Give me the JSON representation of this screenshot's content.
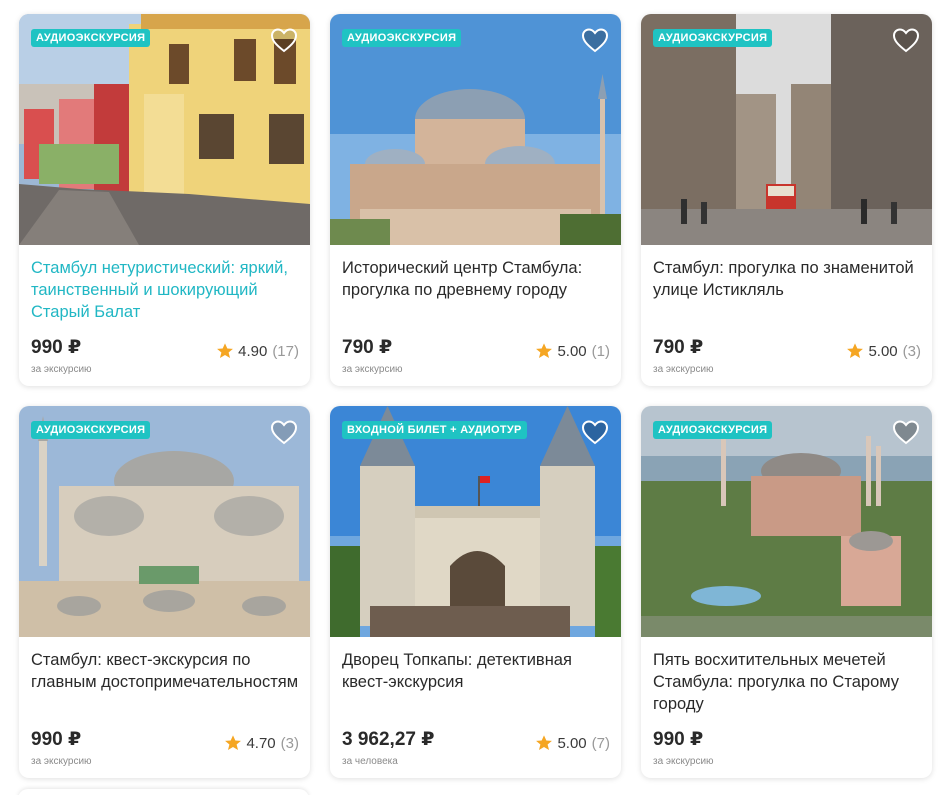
{
  "colors": {
    "badge_bg": "#1fc3c3",
    "title_link": "#21b7c4",
    "star": "#f5a623",
    "heart": "#8f8f8f"
  },
  "cards": [
    {
      "badge": "АУДИОЭКСКУРСИЯ",
      "title": "Стамбул нетуристический: яркий, таинственный и шокирующий Старый Балат",
      "price": "990 ₽",
      "price_note": "за экскурсию",
      "rating": "4.90",
      "reviews": "(17)",
      "image": "balat-colorful-houses"
    },
    {
      "badge": "АУДИОЭКСКУРСИЯ",
      "title": "Исторический центр Стамбула: прогулка по древнему городу",
      "price": "790 ₽",
      "price_note": "за экскурсию",
      "rating": "5.00",
      "reviews": "(1)",
      "image": "hagia-sophia"
    },
    {
      "badge": "АУДИОЭКСКУРСИЯ",
      "title": "Стамбул: прогулка по знаменитой улице Истикляль",
      "price": "790 ₽",
      "price_note": "за экскурсию",
      "rating": "5.00",
      "reviews": "(3)",
      "image": "istiklal-street-tram"
    },
    {
      "badge": "АУДИОЭКСКУРСИЯ",
      "title": "Стамбул: квест-экскурсия по главным достопримечательностям",
      "price": "990 ₽",
      "price_note": "за экскурсию",
      "rating": "4.70",
      "reviews": "(3)",
      "image": "blue-mosque"
    },
    {
      "badge": "ВХОДНОЙ БИЛЕТ + АУДИОТУР",
      "title": "Дворец Топкапы: детективная квест-экскурсия",
      "price": "3 962,27 ₽",
      "price_note": "за человека",
      "rating": "5.00",
      "reviews": "(7)",
      "image": "topkapi-gate"
    },
    {
      "badge": "АУДИОЭКСКУРСИЯ",
      "title": "Пять восхитительных мечетей Стамбула: прогулка по Старому городу",
      "price": "990 ₽",
      "price_note": "за экскурсию",
      "rating": "",
      "reviews": "",
      "image": "aerial-hagia-sophia"
    }
  ]
}
